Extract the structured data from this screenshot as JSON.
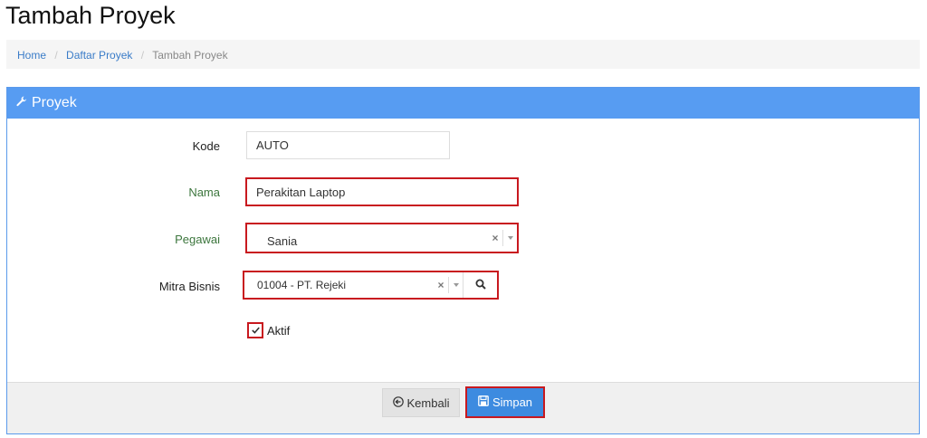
{
  "page": {
    "title": "Tambah Proyek"
  },
  "breadcrumb": {
    "home": "Home",
    "list": "Daftar Proyek",
    "current": "Tambah Proyek"
  },
  "panel": {
    "title": "Proyek",
    "icon": "wrench-icon"
  },
  "form": {
    "kode": {
      "label": "Kode",
      "value": "AUTO"
    },
    "nama": {
      "label": "Nama",
      "value": "Perakitan Laptop"
    },
    "pegawai": {
      "label": "Pegawai",
      "value": "Sania"
    },
    "mitra": {
      "label": "Mitra Bisnis",
      "value": "01004 - PT. Rejeki"
    },
    "aktif": {
      "label": "Aktif",
      "checked": true
    }
  },
  "buttons": {
    "back": "Kembali",
    "save": "Simpan"
  },
  "colors": {
    "accent": "#579cf2",
    "highlight": "#c8191f",
    "required_label": "#3c763d"
  }
}
